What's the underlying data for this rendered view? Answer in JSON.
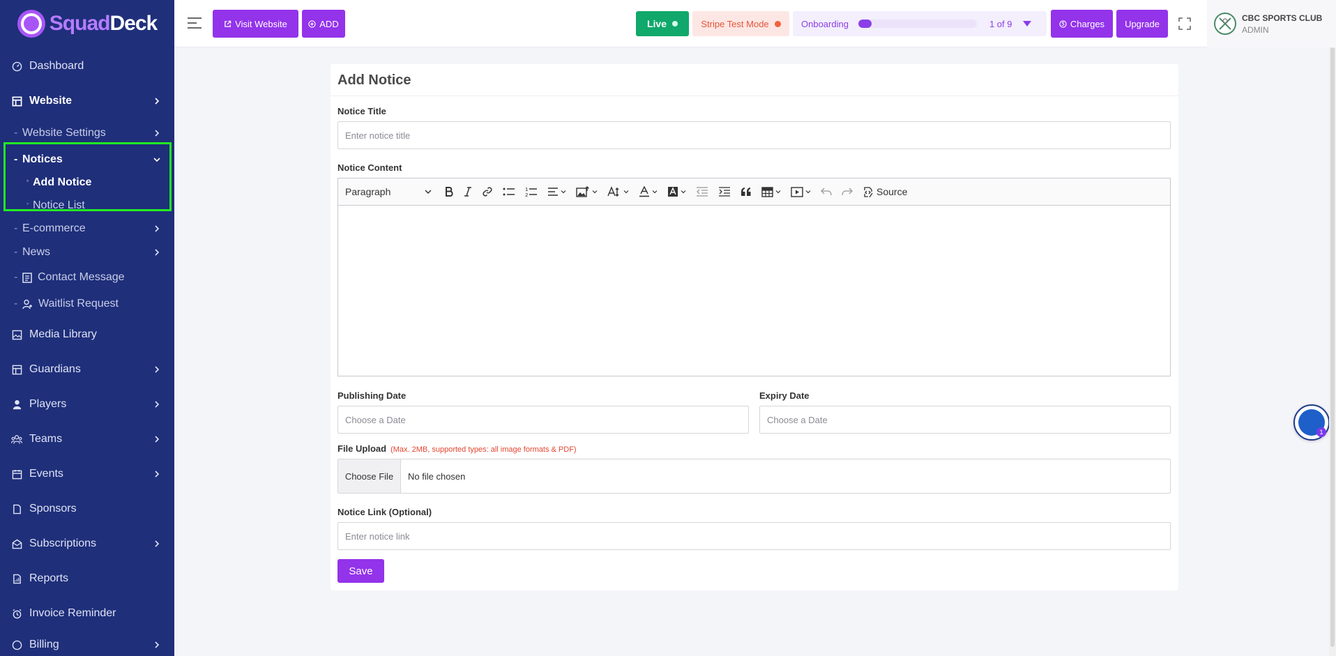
{
  "brand": {
    "part1": "Squad",
    "part2": "Deck"
  },
  "sidebar": {
    "items": [
      {
        "label": "Dashboard"
      },
      {
        "label": "Website"
      },
      {
        "label": "Website Settings"
      },
      {
        "label": "Notices"
      },
      {
        "label": "Add Notice"
      },
      {
        "label": "Notice List"
      },
      {
        "label": "E-commerce"
      },
      {
        "label": "News"
      },
      {
        "label": "Contact Message"
      },
      {
        "label": "Waitlist Request"
      },
      {
        "label": "Media Library"
      },
      {
        "label": "Guardians"
      },
      {
        "label": "Players"
      },
      {
        "label": "Teams"
      },
      {
        "label": "Events"
      },
      {
        "label": "Sponsors"
      },
      {
        "label": "Subscriptions"
      },
      {
        "label": "Reports"
      },
      {
        "label": "Invoice Reminder"
      },
      {
        "label": "Billing"
      }
    ]
  },
  "topbar": {
    "visit_website": "Visit Website",
    "add": "ADD",
    "live": "Live",
    "stripe": "Stripe Test Mode",
    "onboarding": "Onboarding",
    "onboarding_count": "1 of 9",
    "onboarding_progress": 0.11,
    "charges": "Charges",
    "upgrade": "Upgrade",
    "org_name": "CBC SPORTS CLUB",
    "role": "ADMIN"
  },
  "form": {
    "title": "Add Notice",
    "notice_title_label": "Notice Title",
    "notice_title_placeholder": "Enter notice title",
    "notice_content_label": "Notice Content",
    "paragraph": "Paragraph",
    "source": "Source",
    "publishing_date_label": "Publishing Date",
    "publishing_date_placeholder": "Choose a Date",
    "expiry_date_label": "Expiry Date",
    "expiry_date_placeholder": "Choose a Date",
    "file_upload_label": "File Upload",
    "file_upload_hint": "(Max. 2MB, supported types: all image formats & PDF)",
    "choose_file": "Choose File",
    "no_file": "No file chosen",
    "notice_link_label": "Notice Link (Optional)",
    "notice_link_placeholder": "Enter notice link",
    "save": "Save"
  },
  "chat_badge": "1",
  "colors": {
    "sidebar": "#1f2f7a",
    "accent": "#9333ea",
    "live": "#10a86b",
    "highlight": "#22ee22"
  }
}
